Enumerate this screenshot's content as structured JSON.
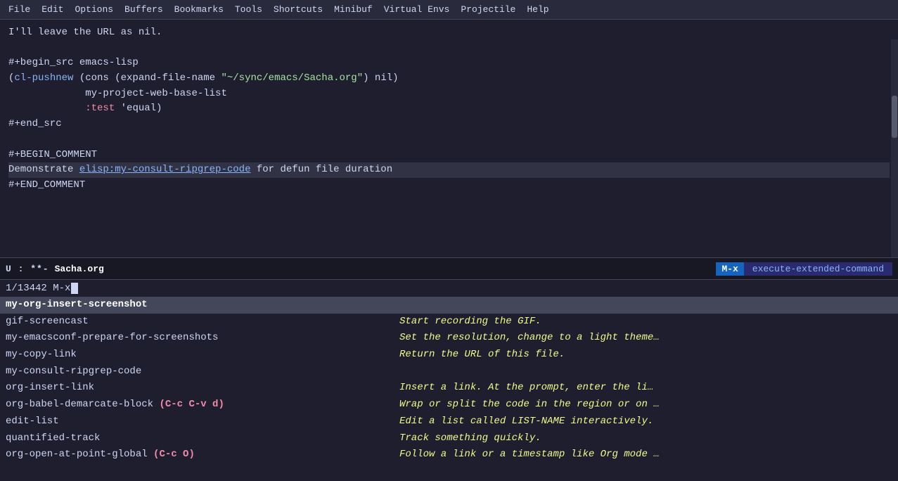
{
  "menubar": {
    "items": [
      "File",
      "Edit",
      "Options",
      "Buffers",
      "Bookmarks",
      "Tools",
      "Shortcuts",
      "Minibuf",
      "Virtual Envs",
      "Projectile",
      "Help"
    ]
  },
  "editor": {
    "lines": [
      {
        "text": "I'll leave the URL as nil.",
        "type": "plain"
      },
      {
        "text": "",
        "type": "plain"
      },
      {
        "text": "#+begin_src emacs-lisp",
        "type": "plain"
      },
      {
        "text": "(cl-pushnew (cons (expand-file-name \"~/sync/emacs/Sacha.org\") nil)",
        "type": "code"
      },
      {
        "text": "             my-project-web-base-list",
        "type": "plain"
      },
      {
        "text": "             :test 'equal)",
        "type": "colon-test"
      },
      {
        "text": "#+end_src",
        "type": "plain"
      },
      {
        "text": "",
        "type": "plain"
      },
      {
        "text": "#+BEGIN_COMMENT",
        "type": "plain"
      },
      {
        "text": "Demonstrate elisp:my-consult-ripgrep-code for defun file duration",
        "type": "highlight"
      },
      {
        "text": "#+END_COMMENT",
        "type": "plain"
      }
    ]
  },
  "modeline": {
    "prefix": "U       :      **-",
    "filename": "Sacha.org",
    "mx_label": "M-x",
    "mx_command": "execute-extended-command"
  },
  "minibuf": {
    "prompt": "1/13442 M-x",
    "input": ""
  },
  "completions": [
    {
      "name": "my-org-insert-screenshot",
      "desc": "",
      "selected": true
    },
    {
      "name": "gif-screencast",
      "desc": "Start recording the GIF.",
      "selected": false
    },
    {
      "name": "my-emacsconf-prepare-for-screenshots",
      "desc": "Set the resolution, change to a light theme…",
      "selected": false
    },
    {
      "name": "my-copy-link",
      "desc": "Return the URL of this file.",
      "selected": false
    },
    {
      "name": "my-consult-ripgrep-code",
      "desc": "",
      "selected": false
    },
    {
      "name": "org-insert-link",
      "desc": "Insert a link.  At the prompt, enter the li…",
      "selected": false
    },
    {
      "name": "org-babel-demarcate-block (C-c C-v d)",
      "desc": "Wrap or split the code in the region or on …",
      "selected": false,
      "has_shortcut": true,
      "shortcut_text": "(C-c C-v d)"
    },
    {
      "name": "edit-list",
      "desc": "Edit a list called LIST-NAME interactively.",
      "selected": false
    },
    {
      "name": "quantified-track",
      "desc": "Track something quickly.",
      "selected": false
    },
    {
      "name": "org-open-at-point-global (C-c O)",
      "desc": "Follow a link or a timestamp like Org mode …",
      "selected": false,
      "has_shortcut": true,
      "shortcut_text": "(C-c O)"
    }
  ]
}
